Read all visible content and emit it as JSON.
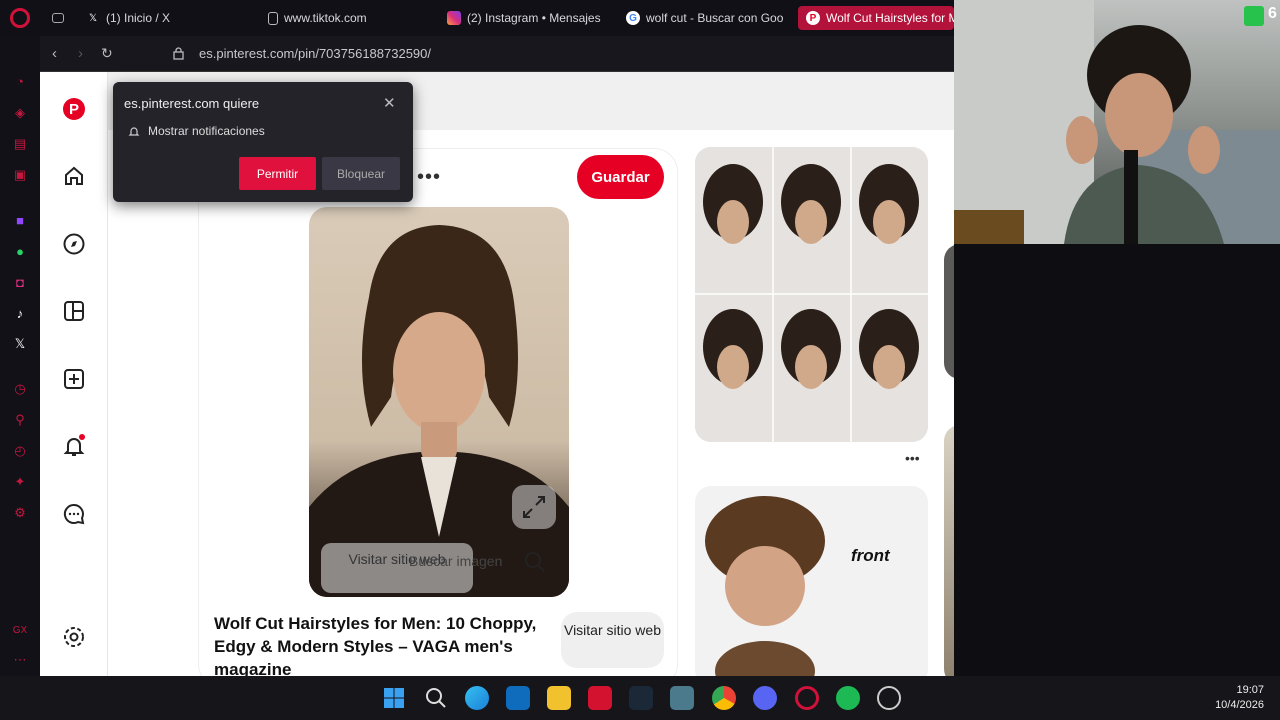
{
  "tabs": [
    {
      "label": "(1) Inicio / X",
      "icon": "x-icon"
    },
    {
      "label": "www.tiktok.com",
      "icon": "page-icon"
    },
    {
      "label": "(2) Instagram • Mensajes",
      "icon": "instagram-icon"
    },
    {
      "label": "wolf cut - Buscar con Goo",
      "icon": "google-icon"
    },
    {
      "label": "Wolf Cut Hairstyles for M",
      "icon": "pinterest-icon"
    }
  ],
  "address": {
    "url": "es.pinterest.com/pin/703756188732590/"
  },
  "notification": {
    "title": "es.pinterest.com quiere",
    "message": "Mostrar notificaciones",
    "allow": "Permitir",
    "block": "Bloquear"
  },
  "pin": {
    "save_label": "Guardar",
    "visit_overlay": "Visitar sitio web",
    "search_image": "Buscar imagen",
    "title": "Wolf Cut Hairstyles for Men: 10 Choppy, Edgy & Modern Styles – VAGA men's magazine",
    "visit_button": "Visitar sitio web"
  },
  "related": {
    "front_label": "front"
  },
  "overlay_counter": "6",
  "clock": {
    "time": "19:07",
    "date": "10/4/2026"
  },
  "colors": {
    "pinterest_red": "#e60023",
    "opera_red": "#d0123b",
    "active_tab": "#b3123b"
  }
}
